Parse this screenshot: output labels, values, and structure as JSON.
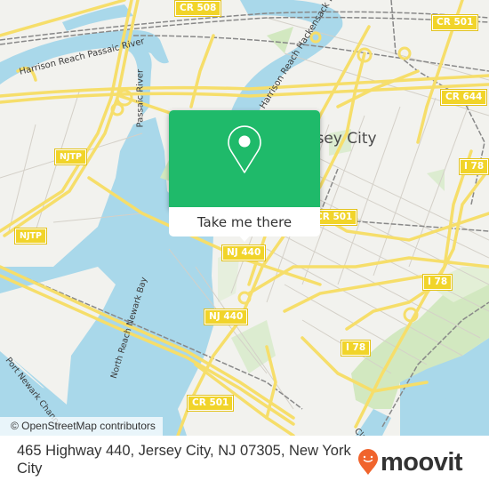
{
  "map": {
    "city_label": "Jersey City",
    "water_labels": [
      "Harrison Reach Passaic River",
      "Passaic River",
      "Harrison Reach Hackensack River",
      "North Reach Newark Bay",
      "Port Newark Channel",
      "Claremont"
    ],
    "road_shields": [
      "CR 508",
      "CR 501",
      "CR 644",
      "NJTP",
      "NJTP",
      "I 78",
      "CR 501",
      "NJ 440",
      "NJ 440",
      "I 78",
      "I 78",
      "CR 501"
    ],
    "attribution": "© OpenStreetMap contributors"
  },
  "popup": {
    "icon": "map-pin-icon",
    "button_label": "Take me there",
    "color": "#1fba6a"
  },
  "footer": {
    "address": "465 Highway 440, Jersey City, NJ 07305, New York City",
    "logo_text": "moovit",
    "logo_color": "#f0642d"
  }
}
